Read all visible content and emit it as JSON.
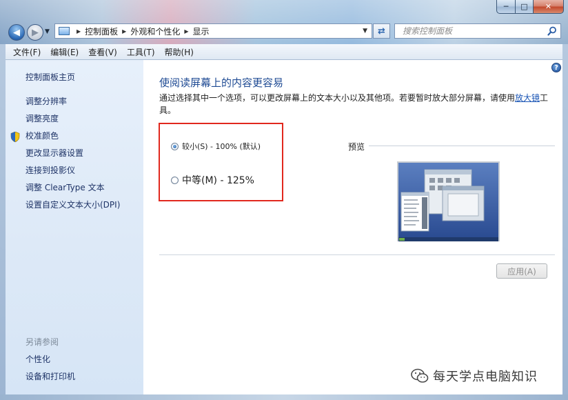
{
  "window": {
    "caption_minimize": "─",
    "caption_maximize": "□",
    "caption_close": "✕"
  },
  "nav": {
    "back_glyph": "◀",
    "forward_glyph": "▶",
    "breadcrumbs": [
      "控制面板",
      "外观和个性化",
      "显示"
    ],
    "refresh_glyph": "⇄",
    "search_placeholder": "搜索控制面板"
  },
  "menu": [
    "文件(F)",
    "编辑(E)",
    "查看(V)",
    "工具(T)",
    "帮助(H)"
  ],
  "sidebar": {
    "home": "控制面板主页",
    "links": [
      "调整分辨率",
      "调整亮度",
      "校准颜色",
      "更改显示器设置",
      "连接到投影仪",
      "调整 ClearType 文本",
      "设置自定义文本大小(DPI)"
    ],
    "see_also_title": "另请参阅",
    "see_also": [
      "个性化",
      "设备和打印机"
    ]
  },
  "main": {
    "title": "使阅读屏幕上的内容更容易",
    "description_before": "通过选择其中一个选项，可以更改屏幕上的文本大小以及其他项。若要暂时放大部分屏幕，请使用",
    "description_link": "放大镜",
    "description_after": "工具。",
    "options": [
      {
        "label": "较小(S) - 100% (默认)",
        "selected": true
      },
      {
        "label": "中等(M) - 125%",
        "selected": false
      }
    ],
    "preview_label": "预览",
    "apply_label": "应用(A)",
    "help_glyph": "?"
  },
  "watermark": "每天学点电脑知识",
  "colors": {
    "title_blue": "#1e4a93",
    "highlight_red": "#e1271d",
    "link_blue": "#1a55b5"
  }
}
